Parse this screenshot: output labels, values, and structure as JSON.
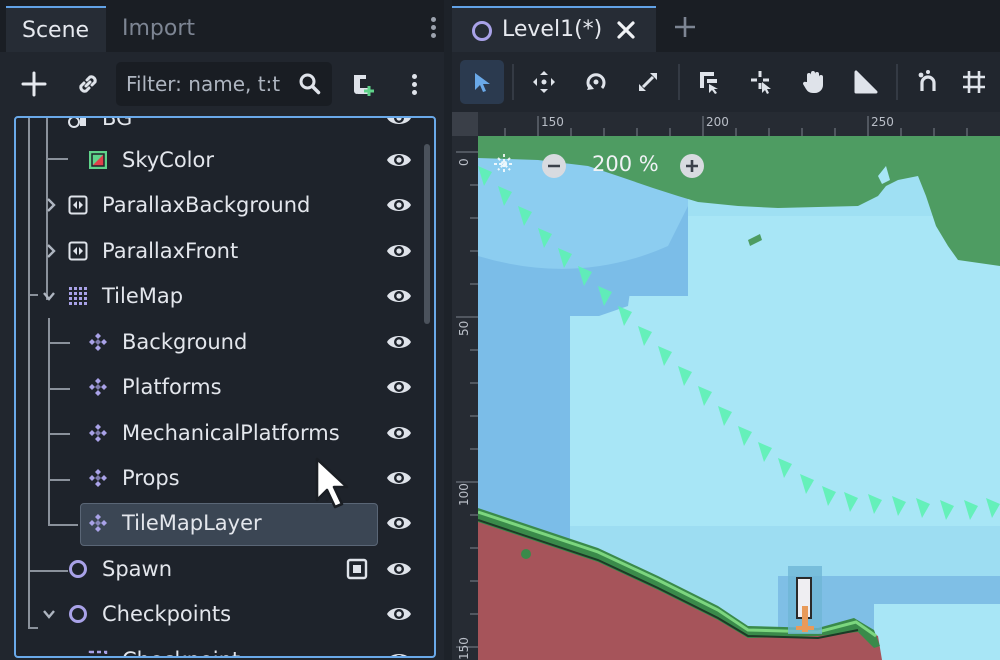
{
  "scene_dock": {
    "tabs": [
      {
        "label": "Scene",
        "active": true
      },
      {
        "label": "Import",
        "active": false
      }
    ],
    "toolbar": {
      "add_node_icon": "plus-icon",
      "link_icon": "link-icon",
      "filter_placeholder": "Filter: name, t:t",
      "filter_value": "",
      "search_icon": "magnifier-icon",
      "script_icon": "attach-script-icon",
      "menu_icon": "vertical-dots-icon"
    },
    "tree": [
      {
        "label": "BG",
        "icon": "node2d-icon",
        "expanded": null
      },
      {
        "label": "SkyColor",
        "icon": "color-rect-icon",
        "expanded": null
      },
      {
        "label": "ParallaxBackground",
        "icon": "parallax-icon",
        "expanded": false
      },
      {
        "label": "ParallaxFront",
        "icon": "parallax-icon",
        "expanded": false
      },
      {
        "label": "TileMap",
        "icon": "tilemap-icon",
        "expanded": true
      },
      {
        "label": "Background",
        "icon": "tilemap-layer-icon",
        "expanded": null
      },
      {
        "label": "Platforms",
        "icon": "tilemap-layer-icon",
        "expanded": null
      },
      {
        "label": "MechanicalPlatforms",
        "icon": "tilemap-layer-icon",
        "expanded": null
      },
      {
        "label": "Props",
        "icon": "tilemap-layer-icon",
        "expanded": null
      },
      {
        "label": "TileMapLayer",
        "icon": "tilemap-layer-icon",
        "expanded": null,
        "selected": true
      },
      {
        "label": "Spawn",
        "icon": "node-circle-icon",
        "expanded": null,
        "extra_icon": "instance-icon"
      },
      {
        "label": "Checkpoints",
        "icon": "node-circle-icon",
        "expanded": true
      },
      {
        "label": "Checkpoint",
        "icon": "area-icon",
        "expanded": null
      }
    ],
    "visibility_icon": "eye-icon"
  },
  "editor": {
    "tabs": [
      {
        "label": "Level1(*)",
        "icon": "scene-circle-icon",
        "close_icon": "close-icon"
      }
    ],
    "new_tab_icon": "plus-icon",
    "toolbar_icons": [
      "select-arrow-icon",
      "move-icon",
      "rotate-icon",
      "scale-icon",
      "list-select-icon",
      "pivot-icon",
      "pan-hand-icon",
      "ruler-icon",
      "snap-magnet-icon",
      "grid-snap-icon"
    ],
    "ruler_top": [
      "150",
      "200",
      "250"
    ],
    "ruler_left": [
      "0",
      "50",
      "100",
      "150"
    ],
    "zoom": {
      "level": "200 %",
      "out_icon": "minus-icon",
      "in_icon": "plus-icon"
    },
    "colors": {
      "accent": "#62a2e6",
      "sky": "#9fe3f6",
      "grass": "#4d9c5f",
      "soil": "#a6545a",
      "trail": "#5ef2b4"
    }
  }
}
